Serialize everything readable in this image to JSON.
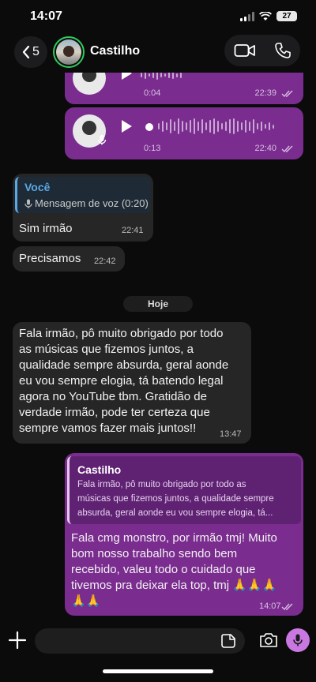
{
  "status": {
    "time": "14:07",
    "battery": "27"
  },
  "header": {
    "back_count": "5",
    "contact_name": "Castilho"
  },
  "messages": {
    "voice1": {
      "duration": "0:04",
      "time": "22:39"
    },
    "voice2": {
      "duration": "0:13",
      "time": "22:40"
    },
    "reply_in": {
      "quote_author": "Você",
      "quote_text": "Mensagem de voz (0:20)",
      "text": "Sim irmão",
      "time": "22:41"
    },
    "msg_precisamos": {
      "text": "Precisamos",
      "time": "22:42"
    },
    "day_separator": "Hoje",
    "long_in": {
      "lines": [
        "Fala irmão, pô muito obrigado por todo",
        "as músicas que fizemos juntos, a",
        "qualidade sempre absurda, geral aonde",
        "eu vou sempre elogia, tá batendo legal",
        "agora no YouTube tbm. Gratidão de",
        "verdade irmão, pode ter certeza que",
        "sempre vamos fazer mais juntos!!"
      ],
      "time": "13:47"
    },
    "reply_out": {
      "quote_author": "Castilho",
      "quote_lines": [
        "Fala irmão, pô muito obrigado por todo as",
        "músicas que fizemos juntos, a qualidade sempre",
        "absurda, geral aonde eu vou sempre elogia, tá..."
      ],
      "lines": [
        "Fala cmg monstro, por irmão tmj! Muito",
        "bom nosso trabalho sendo bem",
        "recebido, valeu todo o cuidado que",
        "tivemos pra deixar ela top, tmj 🙏🙏🙏",
        "🙏🙏"
      ],
      "time": "14:07"
    }
  },
  "input": {
    "placeholder": ""
  },
  "colors": {
    "outgoing": "#7a2c8f",
    "incoming": "#262626",
    "accent_green": "#2ecc5c",
    "quote_blue": "#5aa9e6"
  }
}
